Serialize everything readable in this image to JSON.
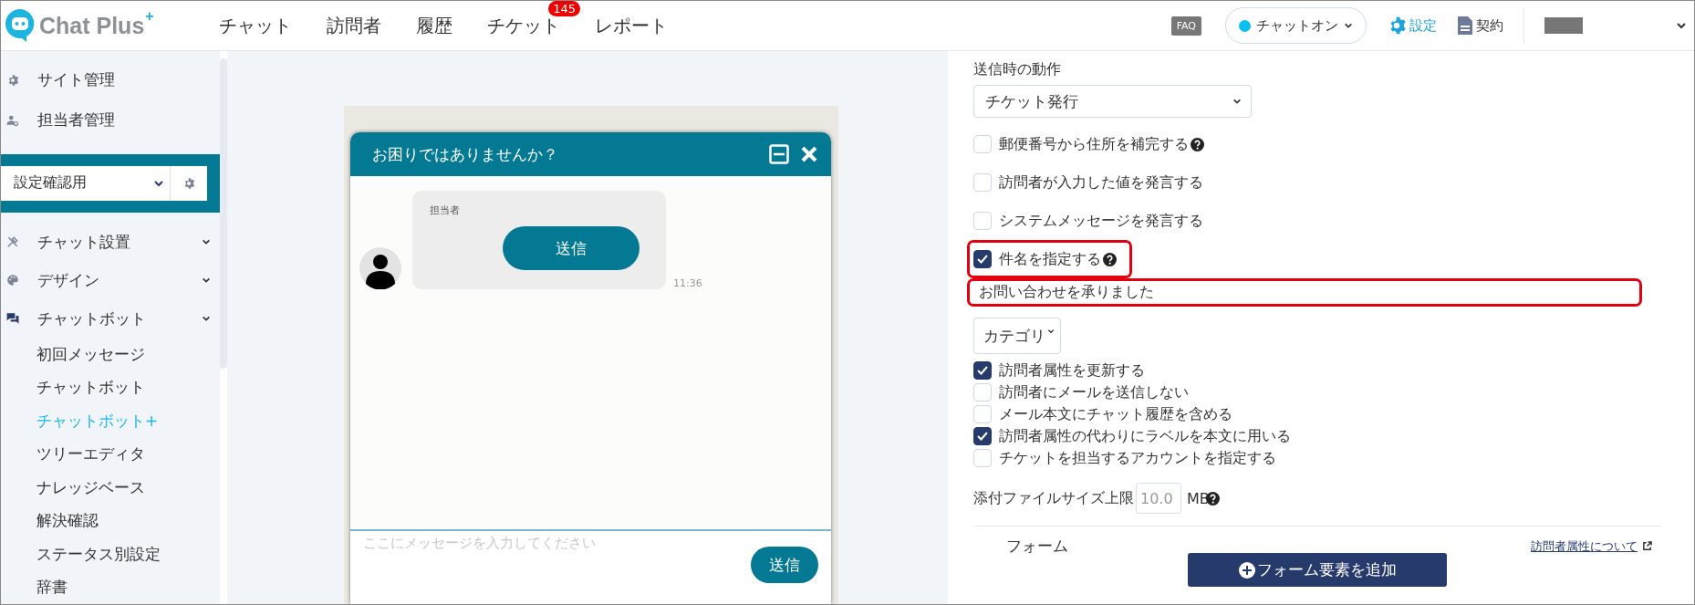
{
  "header": {
    "logo": {
      "text": "Chat Plus",
      "sup": "+"
    },
    "nav": [
      {
        "label": "チャット"
      },
      {
        "label": "訪問者"
      },
      {
        "label": "履歴"
      },
      {
        "label": "チケット",
        "badge": "145"
      },
      {
        "label": "レポート"
      }
    ],
    "faq": "FAQ",
    "chat_status": {
      "label": "チャットオン",
      "on": true
    },
    "settings": "設定",
    "contract": "契約"
  },
  "sidebar": {
    "top_items": [
      {
        "label": "サイト管理"
      },
      {
        "label": "担当者管理"
      }
    ],
    "site_select": {
      "value": "設定確認用"
    },
    "menu": [
      {
        "label": "チャット設置"
      },
      {
        "label": "デザイン"
      },
      {
        "label": "チャットボット",
        "children": [
          {
            "label": "初回メッセージ",
            "selected": false
          },
          {
            "label": "チャットボット",
            "selected": false
          },
          {
            "label": "チャットボット+",
            "selected": true
          },
          {
            "label": "ツリーエディタ",
            "selected": false
          },
          {
            "label": "ナレッジベース",
            "selected": false
          },
          {
            "label": "解決確認",
            "selected": false
          },
          {
            "label": "ステータス別設定",
            "selected": false
          },
          {
            "label": "辞書",
            "selected": false
          }
        ]
      }
    ]
  },
  "preview": {
    "title": "お困りではありませんか？",
    "message": {
      "sender": "担当者",
      "button": "送信",
      "time": "11:36"
    },
    "input": {
      "placeholder": "ここにメッセージを入力してください",
      "send": "送信"
    }
  },
  "settings_panel": {
    "action_label": "送信時の動作",
    "action_value": "チケット発行",
    "options_a": [
      {
        "label": "郵便番号から住所を補完する",
        "checked": false,
        "help": true,
        "highlighted": false
      },
      {
        "label": "訪問者が入力した値を発言する",
        "checked": false,
        "help": false,
        "highlighted": false
      },
      {
        "label": "システムメッセージを発言する",
        "checked": false,
        "help": false,
        "highlighted": false
      },
      {
        "label": "件名を指定する",
        "checked": true,
        "help": true,
        "highlighted": true
      }
    ],
    "subject": {
      "value": "お問い合わせを承りました",
      "highlighted": true
    },
    "category": "カテゴリ",
    "options_b": [
      {
        "label": "訪問者属性を更新する",
        "checked": true
      },
      {
        "label": "訪問者にメールを送信しない",
        "checked": false
      },
      {
        "label": "メール本文にチャット履歴を含める",
        "checked": false
      },
      {
        "label": "訪問者属性の代わりにラベルを本文に用いる",
        "checked": true
      },
      {
        "label": "チケットを担当するアカウントを指定する",
        "checked": false
      }
    ],
    "file_size": {
      "label": "添付ファイルサイズ上限",
      "placeholder": "10.0",
      "unit": "MB"
    },
    "form": {
      "title": "フォーム",
      "link": "訪問者属性について",
      "add_button": "フォーム要素を追加"
    }
  }
}
